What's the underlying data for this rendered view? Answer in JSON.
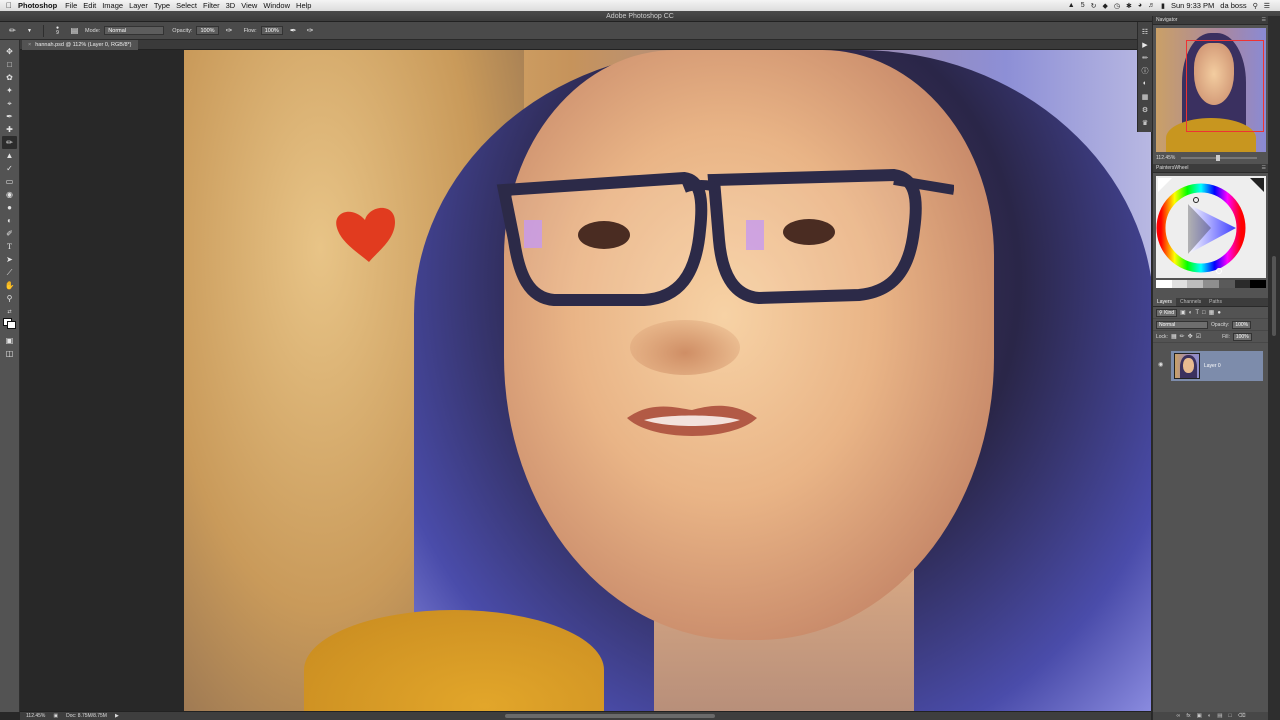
{
  "menubar": {
    "app": "Photoshop",
    "items": [
      "File",
      "Edit",
      "Image",
      "Layer",
      "Type",
      "Select",
      "Filter",
      "3D",
      "View",
      "Window",
      "Help"
    ],
    "battery_number": "5",
    "clock": "Sun 9:33 PM",
    "user": "da boss"
  },
  "window": {
    "title": "Adobe Photoshop CC"
  },
  "options": {
    "brush_size": "9",
    "mode_label": "Mode:",
    "mode_value": "Normal",
    "opacity_label": "Opacity:",
    "opacity_value": "100%",
    "flow_label": "Flow:",
    "flow_value": "100%"
  },
  "document": {
    "tab_title": "hannah.psd @ 112% (Layer 0, RGB/8*)"
  },
  "status": {
    "zoom": "112.45%",
    "doc_size": "Doc: 8.75M/8.75M"
  },
  "navigator": {
    "title": "Navigator",
    "zoom": "112.45%"
  },
  "painterswheel": {
    "title": "PaintersWheel"
  },
  "layers": {
    "tabs": [
      "Layers",
      "Channels",
      "Paths"
    ],
    "filter_kind": "Kind",
    "blend_mode": "Normal",
    "opacity_label": "Opacity:",
    "opacity_value": "100%",
    "lock_label": "Lock:",
    "fill_label": "Fill:",
    "fill_value": "100%",
    "layer_name": "Layer 0"
  },
  "colors": {
    "panel_bg": "#535353",
    "selection": "#7d8cab",
    "heart": "#e13b1f",
    "navigator_box": "#ee3333"
  }
}
